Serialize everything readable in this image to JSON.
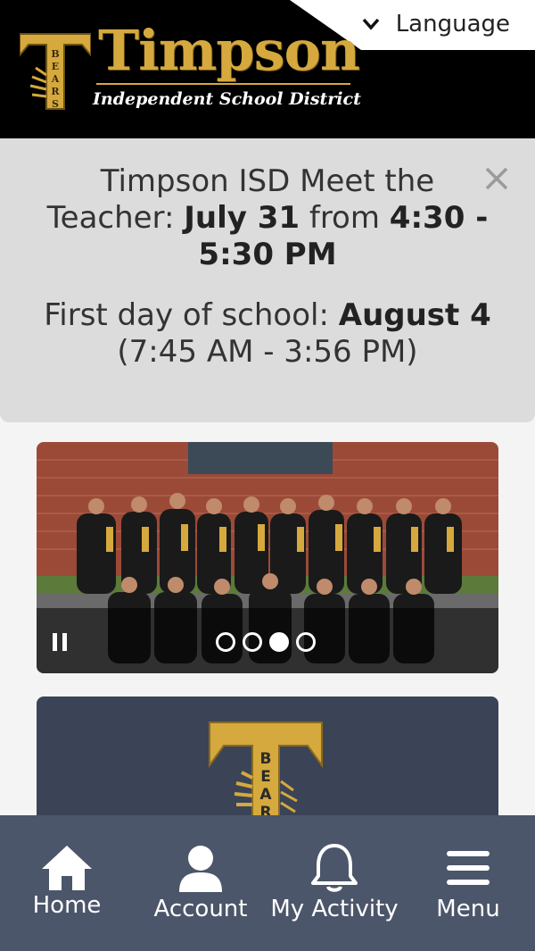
{
  "header": {
    "language_label": "Language",
    "logo_word": "Timpson",
    "logo_subtitle": "Independent School District",
    "logo_t_letters": "BEARS",
    "brand_gold": "#d5a93d"
  },
  "alert": {
    "line1": "Timpson ISD Meet the",
    "line2_prefix": "Teacher: ",
    "line2_date": "July 31",
    "line2_mid": " from ",
    "line2_time": "4:30 -",
    "line3_time": "5:30 PM",
    "line4_prefix": "First day of school: ",
    "line4_date": "August 4",
    "line5": "(7:45 AM - 3:56 PM)",
    "close_icon": "close-icon"
  },
  "slideshow": {
    "slide_count": 4,
    "active_index": 3,
    "pause_icon": "pause-icon"
  },
  "bottom_nav": {
    "items": [
      {
        "label": "Home",
        "icon": "home-icon"
      },
      {
        "label": "Account",
        "icon": "user-icon"
      },
      {
        "label": "My Activity",
        "icon": "bell-icon"
      },
      {
        "label": "Menu",
        "icon": "hamburger-menu-icon"
      }
    ],
    "background": "#4c566a"
  }
}
